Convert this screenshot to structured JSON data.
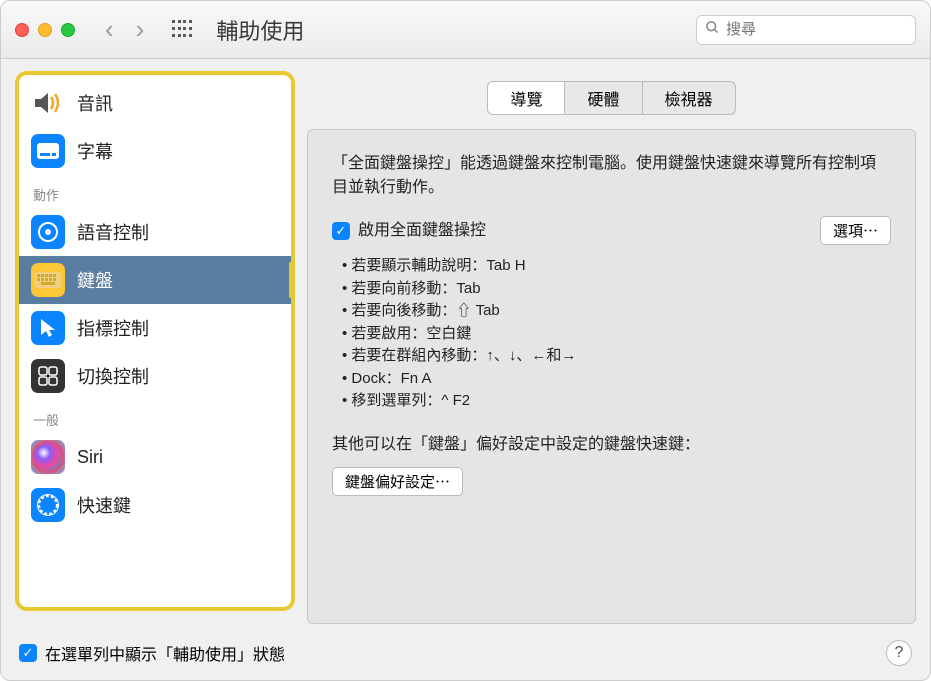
{
  "window": {
    "title": "輔助使用",
    "search_placeholder": "搜尋"
  },
  "sidebar": {
    "items": [
      {
        "label": "音訊",
        "icon": "speaker-icon"
      },
      {
        "label": "字幕",
        "icon": "captions-icon"
      }
    ],
    "section_motor": "動作",
    "motor_items": [
      {
        "label": "語音控制",
        "icon": "voice-control-icon"
      },
      {
        "label": "鍵盤",
        "icon": "keyboard-icon"
      },
      {
        "label": "指標控制",
        "icon": "pointer-icon"
      },
      {
        "label": "切換控制",
        "icon": "switch-control-icon"
      }
    ],
    "section_general": "一般",
    "general_items": [
      {
        "label": "Siri",
        "icon": "siri-icon"
      },
      {
        "label": "快速鍵",
        "icon": "shortcut-icon"
      }
    ]
  },
  "tabs": {
    "navigation": "導覽",
    "hardware": "硬體",
    "viewer": "檢視器"
  },
  "panel": {
    "description": "「全面鍵盤操控」能透過鍵盤來控制電腦。使用鍵盤快速鍵來導覽所有控制項目並執行動作。",
    "enable_label": "啟用全面鍵盤操控",
    "options_button": "選項⋯",
    "bullets": [
      "若要顯示輔助說明：Tab H",
      "若要向前移動：Tab",
      "若要向後移動：⇧ Tab",
      "若要啟用：空白鍵",
      "若要在群組內移動：↑、↓、←和→",
      "Dock：Fn A",
      "移到選單列：^ F2"
    ],
    "other_shortcuts_label": "其他可以在「鍵盤」偏好設定中設定的鍵盤快速鍵：",
    "keyboard_prefs_button": "鍵盤偏好設定⋯"
  },
  "footer": {
    "menubar_status_label": "在選單列中顯示「輔助使用」狀態"
  }
}
